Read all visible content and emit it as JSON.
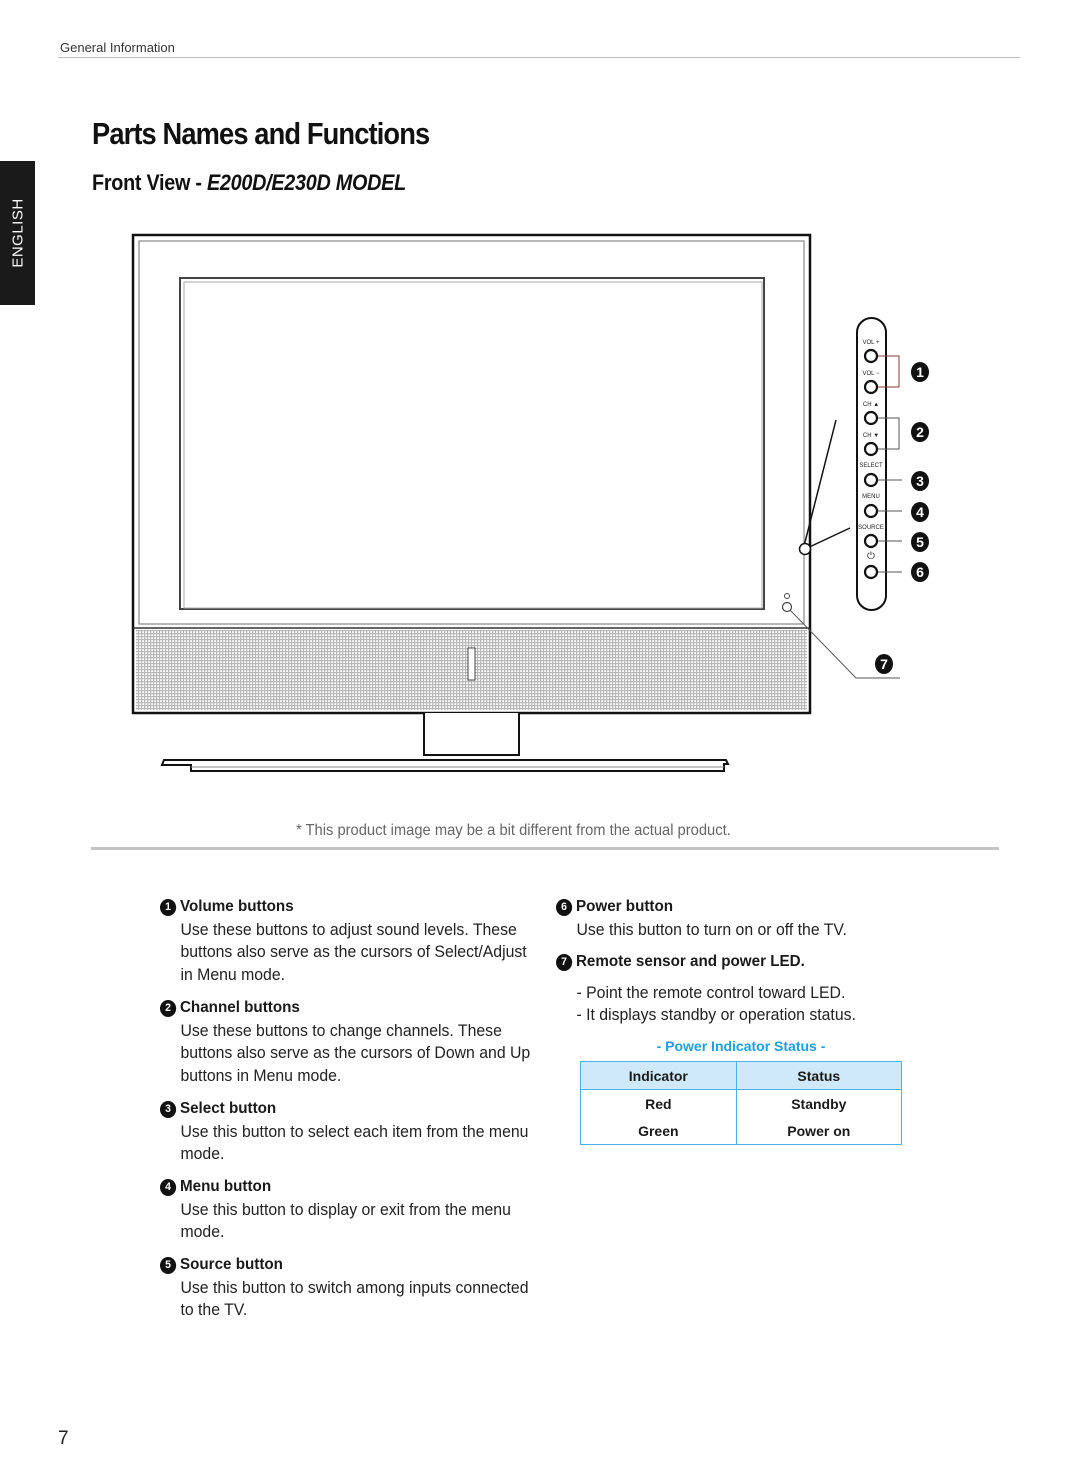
{
  "header": {
    "section": "General Information"
  },
  "page_title": "Parts Names and Functions",
  "subtitle": {
    "prefix": "Front View",
    "separator": " - ",
    "model": "E200D/E230D MODEL"
  },
  "language_tab": "ENGLISH",
  "diagram": {
    "panel_labels": [
      "VOL +",
      "VOL −",
      "CH ▲",
      "CH ▼",
      "SELECT",
      "MENU",
      "SOURCE",
      "⏻"
    ],
    "callouts": [
      "1",
      "2",
      "3",
      "4",
      "5",
      "6",
      "7"
    ]
  },
  "note": "* This product image may be a bit different from the actual product.",
  "items": [
    {
      "num": "1",
      "title": "Volume buttons",
      "desc": "Use these buttons to adjust sound levels. These buttons also serve as the cursors of Select/Adjust in Menu mode."
    },
    {
      "num": "2",
      "title": "Channel buttons",
      "desc": "Use these buttons to change channels. These buttons also serve as the cursors of Down and Up buttons in Menu mode."
    },
    {
      "num": "3",
      "title": "Select button",
      "desc": "Use this button to select each item from the menu mode."
    },
    {
      "num": "4",
      "title": "Menu button",
      "desc": "Use this button to display or exit from the menu mode."
    },
    {
      "num": "5",
      "title": "Source button",
      "desc": "Use this button to switch among inputs connected to the TV."
    },
    {
      "num": "6",
      "title": "Power button",
      "desc": "Use this button to turn on or off the TV."
    },
    {
      "num": "7",
      "title": "Remote sensor and power LED.",
      "bullets": [
        "- Point the remote control toward LED.",
        "- It displays standby or operation status."
      ]
    }
  ],
  "power_indicator": {
    "title": "- Power Indicator Status -",
    "headers": [
      "Indicator",
      "Status"
    ],
    "rows": [
      [
        "Red",
        "Standby"
      ],
      [
        "Green",
        "Power on"
      ]
    ]
  },
  "page_number": "7",
  "colors": {
    "accent": "#1a9fe0",
    "table_border": "#4fb3e8",
    "table_header_bg": "#cfe9f8"
  }
}
